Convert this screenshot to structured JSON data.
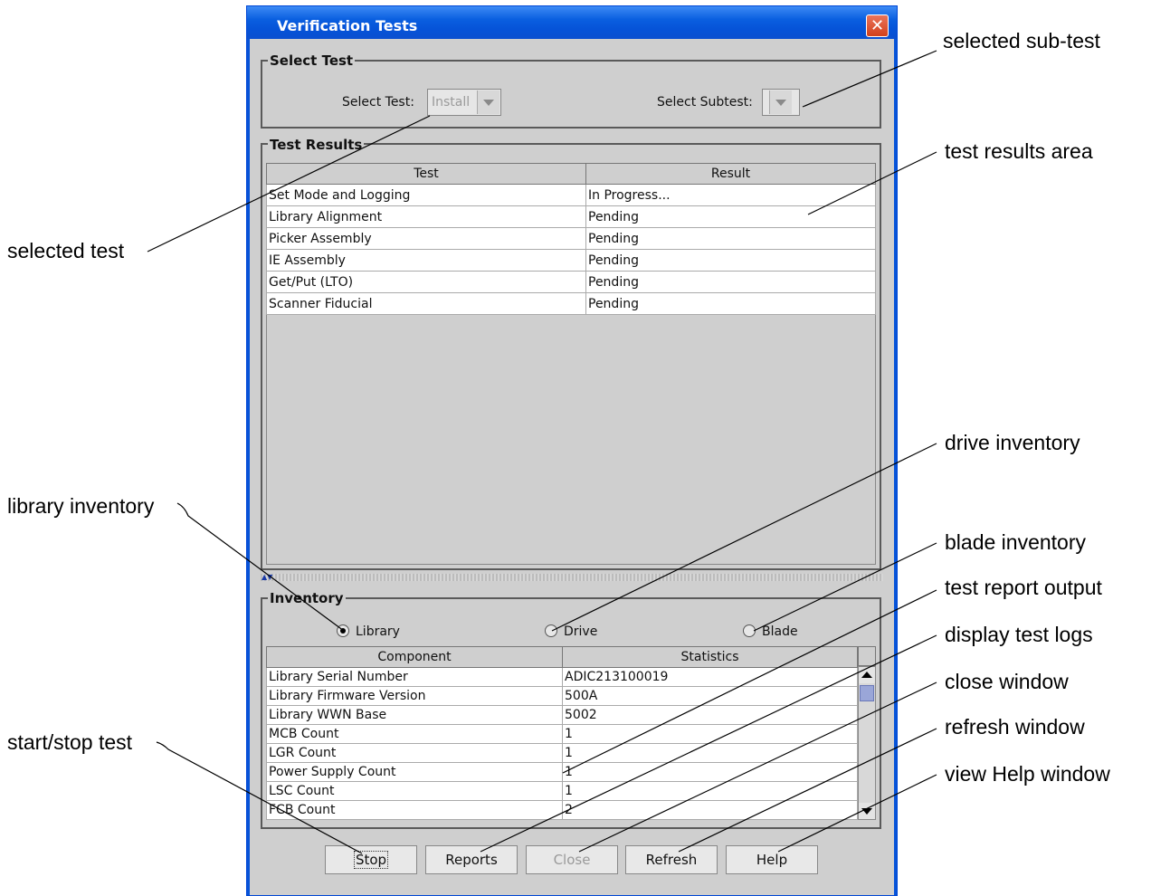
{
  "window": {
    "title": "Verification Tests",
    "close_glyph": "✕"
  },
  "select_test": {
    "group_title": "Select Test",
    "test_label": "Select Test:",
    "test_value": "Install",
    "subtest_label": "Select Subtest:",
    "subtest_value": ""
  },
  "test_results": {
    "group_title": "Test Results",
    "columns": [
      "Test",
      "Result"
    ],
    "rows": [
      [
        "Set Mode and Logging",
        "In Progress..."
      ],
      [
        "Library Alignment",
        "Pending"
      ],
      [
        "Picker Assembly",
        "Pending"
      ],
      [
        "IE Assembly",
        "Pending"
      ],
      [
        "Get/Put (LTO)",
        "Pending"
      ],
      [
        "Scanner Fiducial",
        "Pending"
      ]
    ]
  },
  "inventory": {
    "group_title": "Inventory",
    "radios": [
      {
        "label": "Library",
        "selected": true
      },
      {
        "label": "Drive",
        "selected": false
      },
      {
        "label": "Blade",
        "selected": false
      }
    ],
    "columns": [
      "Component",
      "Statistics"
    ],
    "rows": [
      [
        "Library Serial Number",
        "ADIC213100019"
      ],
      [
        "Library Firmware Version",
        "500A"
      ],
      [
        "Library WWN Base",
        "5002"
      ],
      [
        "MCB Count",
        "1"
      ],
      [
        "LGR Count",
        "1"
      ],
      [
        "Power Supply Count",
        "1"
      ],
      [
        "LSC Count",
        "1"
      ],
      [
        "FCB Count",
        "2"
      ]
    ]
  },
  "buttons": {
    "stop": "Stop",
    "reports": "Reports",
    "close": "Close",
    "refresh": "Refresh",
    "help": "Help"
  },
  "callouts": {
    "selected_subtest": "selected sub-test",
    "test_results_area": "test results area",
    "selected_test": "selected test",
    "drive_inventory": "drive inventory",
    "library_inventory": "library inventory",
    "blade_inventory": "blade inventory",
    "test_report_output": "test report output",
    "display_test_logs": "display test logs",
    "close_window": "close window",
    "refresh_window": "refresh window",
    "start_stop_test": "start/stop test",
    "view_help_window": "view Help window"
  },
  "colors": {
    "title_bar": "#0653d8",
    "window_bg": "#cfcfcf",
    "close_button": "#d3401b"
  }
}
